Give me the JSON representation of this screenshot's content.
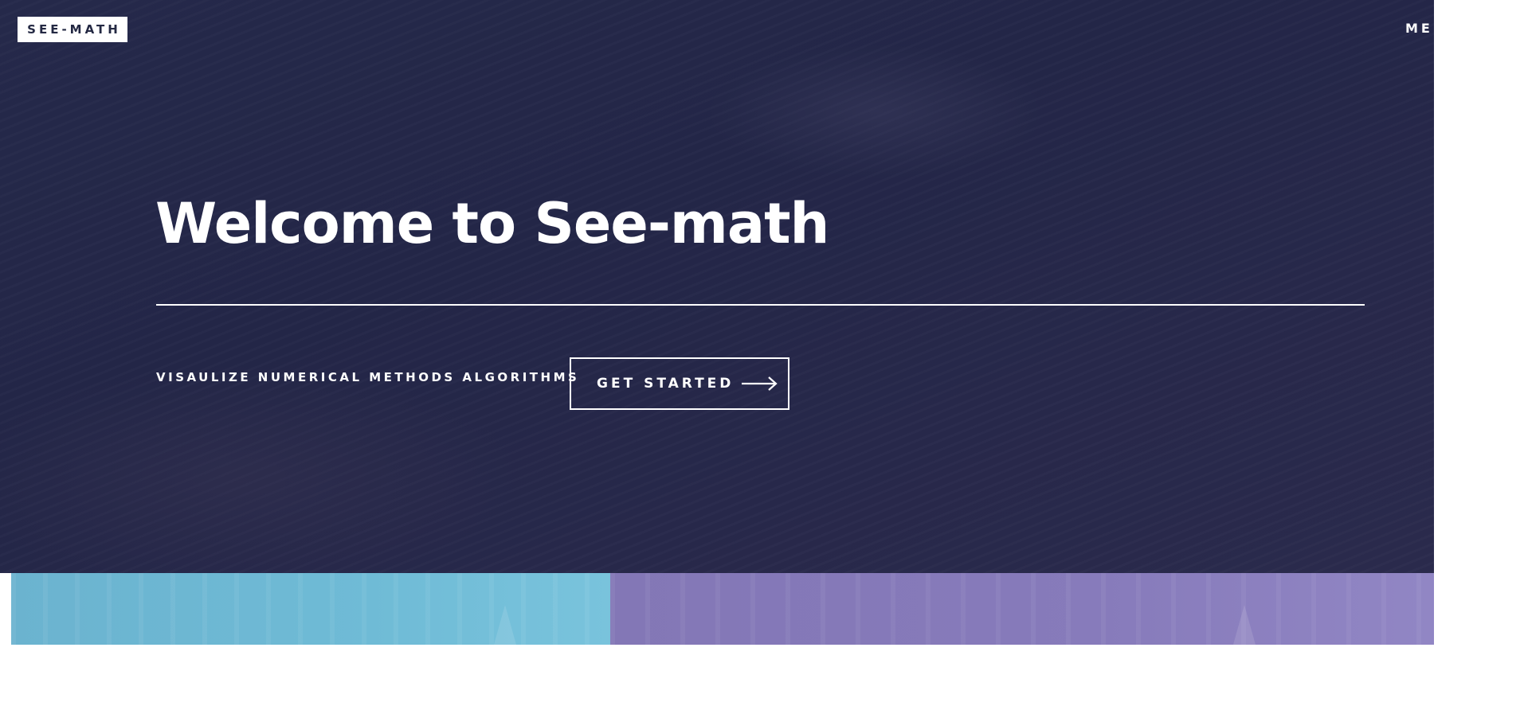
{
  "header": {
    "logo_text": "SEE-MATH",
    "menu_label": "ME"
  },
  "hero": {
    "title": "Welcome to See-math",
    "tagline": "VISAULIZE NUMERICAL METHODS ALGORITHMS",
    "cta_label": "GET STARTED",
    "cta_icon": "arrow-right-icon"
  },
  "tiles": [
    {
      "name": "tile-blue",
      "color": "#6fbbd6"
    },
    {
      "name": "tile-purple",
      "color": "#877bbb"
    }
  ],
  "colors": {
    "hero_background": "#24284a",
    "logo_text": "#242943",
    "text": "#ffffff"
  }
}
